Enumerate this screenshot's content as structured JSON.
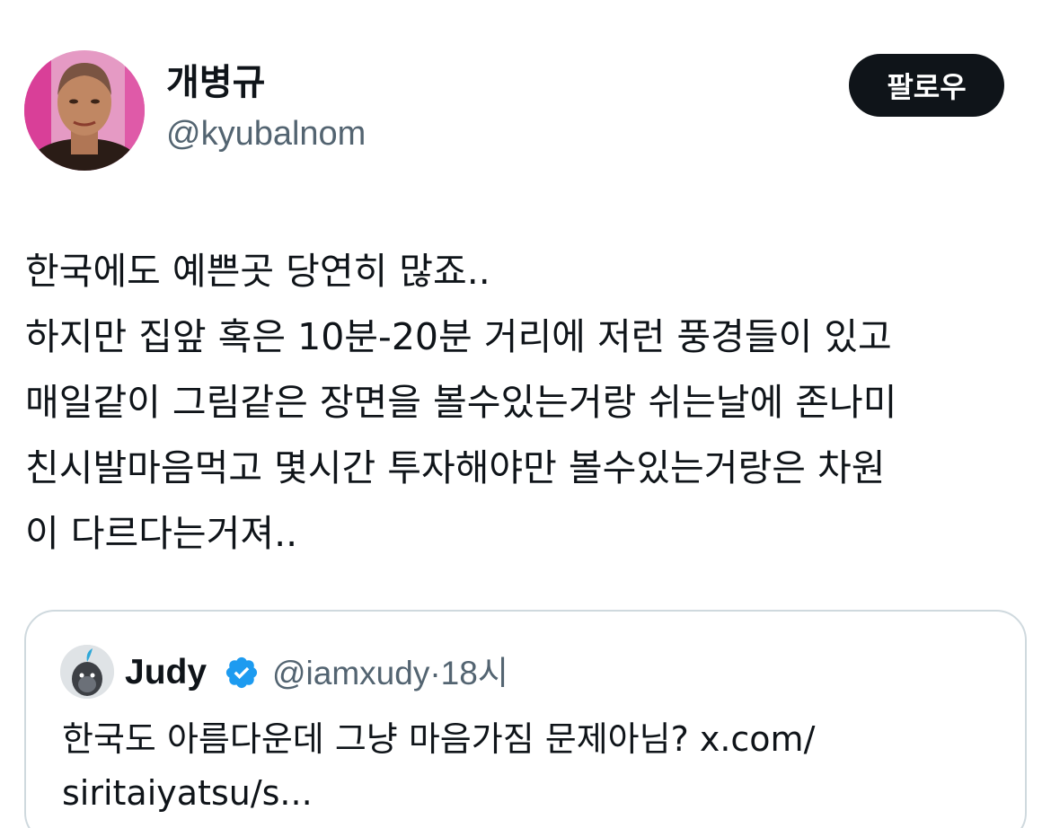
{
  "author": {
    "display_name": "개병규",
    "handle": "@kyubalnom",
    "avatar_icon": "profile-photo"
  },
  "follow_button": {
    "label": "팔로우"
  },
  "tweet": {
    "lines": [
      "한국에도 예쁜곳 당연히 많죠..",
      "하지만 집앞 혹은 10분-20분 거리에 저런 풍경들이 있고",
      "매일같이 그림같은 장면을 볼수있는거랑 쉬는날에 존나미",
      "친시발마음먹고 몇시간 투자해야만 볼수있는거랑은 차원",
      "이 다르다는거져.."
    ]
  },
  "quoted_tweet": {
    "display_name": "Judy",
    "verified_icon": "verified-badge",
    "handle": "@iamxudy",
    "separator": "·",
    "time": "18시",
    "lines": [
      "한국도 아름다운데 그냥 마음가짐 문제아님? x.com/",
      "siritaiyatsu/s..."
    ]
  },
  "colors": {
    "text": "#0f1419",
    "secondary": "#536471",
    "border": "#cfd9de",
    "follow_bg": "#0f1419",
    "verified": "#1d9bf0"
  }
}
